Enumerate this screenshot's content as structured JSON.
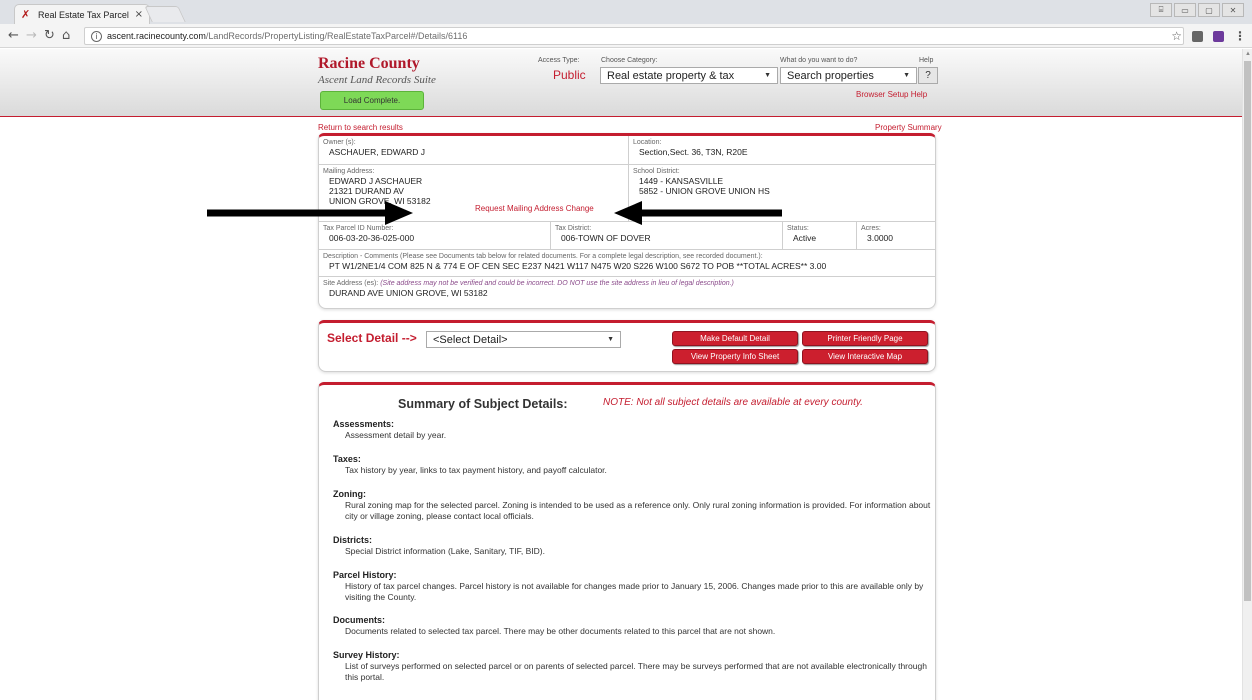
{
  "browser": {
    "tab_title": "Real Estate Tax Parcel",
    "tab_close": "×",
    "url_host": "ascent.racinecounty.com",
    "url_path": "/LandRecords/PropertyListing/RealEstateTaxParcel#/Details/6116",
    "win_controls": [
      "⌸",
      "▭",
      "▢",
      "✕"
    ]
  },
  "header": {
    "brand_title": "Racine County",
    "brand_subtitle": "Ascent Land Records Suite",
    "load_status": "Load Complete.",
    "access_type_label": "Access Type:",
    "access_type_value": "Public",
    "category_label": "Choose Category:",
    "category_value": "Real estate property & tax",
    "action_label": "What do you want to do?",
    "action_value": "Search properties",
    "help_label": "Help",
    "help_button": "?",
    "setup_help": "Browser Setup Help"
  },
  "links": {
    "return": "Return to search results",
    "summary": "Property Summary",
    "request_mailing": "Request Mailing Address Change"
  },
  "parcel": {
    "owner_label": "Owner (s):",
    "owner": "ASCHAUER, EDWARD J",
    "location_label": "Location:",
    "location": "Section,Sect. 36, T3N, R20E",
    "mailing_label": "Mailing Address:",
    "mailing_lines": [
      "EDWARD J ASCHAUER",
      "21321 DURAND AV",
      "UNION GROVE, WI 53182"
    ],
    "school_label": "School District:",
    "school_lines": [
      "1449 - KANSASVILLE",
      "5852 - UNION GROVE UNION HS"
    ],
    "parcel_id_label": "Tax Parcel ID Number:",
    "parcel_id": "006-03-20-36-025-000",
    "tax_district_label": "Tax District:",
    "tax_district": "006-TOWN OF DOVER",
    "status_label": "Status:",
    "status": "Active",
    "acres_label": "Acres:",
    "acres": "3.0000",
    "description_label": "Description - Comments (Please see Documents tab below for related documents. For a complete legal description, see recorded document.):",
    "description": "PT W1/2NE1/4 COM 825 N & 774 E OF CEN SEC E237 N421 W117 N475 W20 S226 W100 S672 TO POB **TOTAL ACRES** 3.00",
    "site_label": "Site Address (es):",
    "site_note": "(Site address may not be verified and could be incorrect. DO NOT use the site address in lieu of legal description.)",
    "site_address": "DURAND AVE UNION GROVE, WI 53182"
  },
  "select_detail": {
    "label": "Select Detail -->",
    "value": "<Select Detail>",
    "buttons": [
      "Make Default Detail",
      "Printer Friendly Page",
      "View Property Info Sheet",
      "View Interactive Map"
    ]
  },
  "summary": {
    "title": "Summary of Subject Details:",
    "note": "NOTE: Not all subject details are available at every county.",
    "items": [
      {
        "title": "Assessments:",
        "desc": "Assessment detail by year."
      },
      {
        "title": "Taxes:",
        "desc": "Tax history by year, links to tax payment history, and payoff calculator."
      },
      {
        "title": "Zoning:",
        "desc": "Rural zoning map for the selected parcel. Zoning is intended to be used as a reference only. Only rural zoning information is provided. For information about city or village zoning, please contact local officials."
      },
      {
        "title": "Districts:",
        "desc": "Special District information (Lake, Sanitary, TIF, BID)."
      },
      {
        "title": "Parcel History:",
        "desc": "History of tax parcel changes. Parcel history is not available for changes made prior to January 15, 2006. Changes made prior to this are available only by visiting the County."
      },
      {
        "title": "Documents:",
        "desc": "Documents related to selected tax parcel. There may be other documents related to this parcel that are not shown."
      },
      {
        "title": "Survey History:",
        "desc": "List of surveys performed on selected parcel or on parents of selected parcel. There may be surveys performed that are not available electronically through this portal."
      }
    ]
  }
}
